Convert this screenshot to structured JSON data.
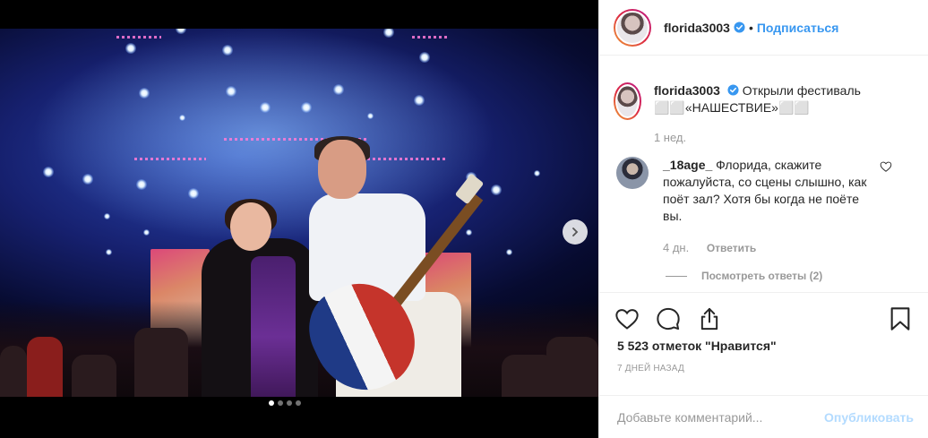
{
  "post": {
    "image_alt": "concert",
    "slide_count": 4,
    "active_slide": 1
  },
  "header": {
    "username": "florida3003",
    "separator": "•",
    "follow_label": "Подписаться"
  },
  "caption": {
    "username": "florida3003",
    "text": "Открыли фестиваль ⬜⬜«НАШЕСТВИЕ»⬜⬜",
    "time": "1 нед."
  },
  "comments": [
    {
      "username": "_18age_",
      "text": "Флорида, скажите пожалуйста, со сцены слышно, как поёт зал? Хотя бы когда не поёте вы.",
      "time": "4 дн.",
      "reply_label": "Ответить",
      "view_replies_label": "Посмотреть ответы (2)"
    }
  ],
  "stats": {
    "likes_label": "5 523 отметок \"Нравится\"",
    "date_label": "7 ДНЕЙ НАЗАД"
  },
  "add_comment": {
    "placeholder": "Добавьте комментарий...",
    "publish_label": "Опубликовать"
  },
  "colors": {
    "accent": "#3897f0",
    "publish_disabled": "#b3dbff",
    "text": "#262626",
    "muted": "#999999"
  },
  "icons": [
    "chevron-right-icon",
    "verified-icon",
    "heart-icon",
    "comment-icon",
    "share-icon",
    "bookmark-icon",
    "heart-small-icon"
  ]
}
